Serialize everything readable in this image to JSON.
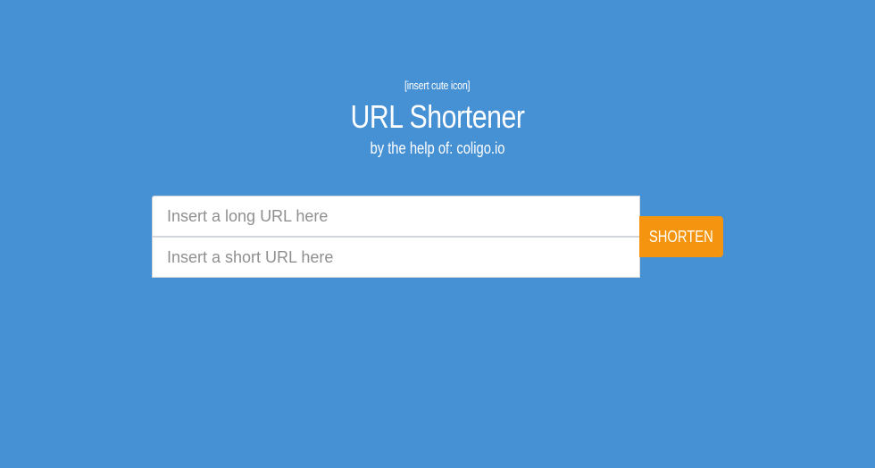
{
  "header": {
    "icon_placeholder": "[insert cute icon]",
    "title": "URL Shortener",
    "subtitle": "by the help of: coligo.io"
  },
  "form": {
    "long_url_placeholder": "Insert a long URL here",
    "short_url_placeholder": "Insert a short URL here",
    "submit_label": "SHORTEN"
  },
  "colors": {
    "background": "#4690d4",
    "button": "#f5950f",
    "text": "#ffffff",
    "placeholder": "#8f8f8f"
  }
}
